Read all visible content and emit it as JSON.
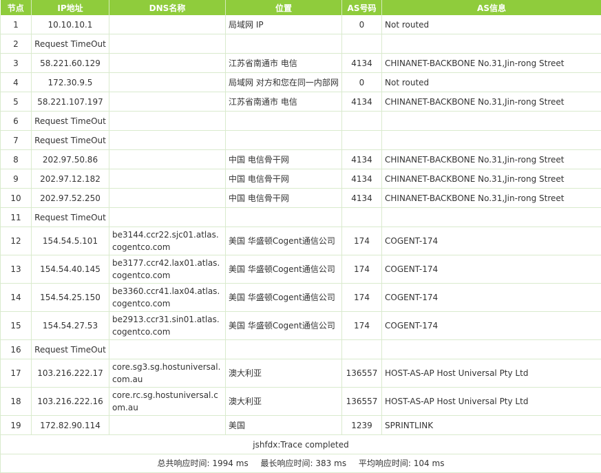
{
  "headers": {
    "node": "节点",
    "ip": "IP地址",
    "dns": "DNS名称",
    "location": "位置",
    "asn": "AS号码",
    "asinfo": "AS信息"
  },
  "rows": [
    {
      "node": "1",
      "ip": "10.10.10.1",
      "dns": "",
      "location": "局域网 IP",
      "asn": "0",
      "asinfo": "Not routed"
    },
    {
      "node": "2",
      "ip": "Request TimeOut",
      "dns": "",
      "location": "",
      "asn": "",
      "asinfo": ""
    },
    {
      "node": "3",
      "ip": "58.221.60.129",
      "dns": "",
      "location": "江苏省南通市 电信",
      "asn": "4134",
      "asinfo": "CHINANET-BACKBONE No.31,Jin-rong Street"
    },
    {
      "node": "4",
      "ip": "172.30.9.5",
      "dns": "",
      "location": "局域网 对方和您在同一内部网",
      "asn": "0",
      "asinfo": "Not routed"
    },
    {
      "node": "5",
      "ip": "58.221.107.197",
      "dns": "",
      "location": "江苏省南通市 电信",
      "asn": "4134",
      "asinfo": "CHINANET-BACKBONE No.31,Jin-rong Street"
    },
    {
      "node": "6",
      "ip": "Request TimeOut",
      "dns": "",
      "location": "",
      "asn": "",
      "asinfo": ""
    },
    {
      "node": "7",
      "ip": "Request TimeOut",
      "dns": "",
      "location": "",
      "asn": "",
      "asinfo": ""
    },
    {
      "node": "8",
      "ip": "202.97.50.86",
      "dns": "",
      "location": "中国 电信骨干网",
      "asn": "4134",
      "asinfo": "CHINANET-BACKBONE No.31,Jin-rong Street"
    },
    {
      "node": "9",
      "ip": "202.97.12.182",
      "dns": "",
      "location": "中国 电信骨干网",
      "asn": "4134",
      "asinfo": "CHINANET-BACKBONE No.31,Jin-rong Street"
    },
    {
      "node": "10",
      "ip": "202.97.52.250",
      "dns": "",
      "location": "中国 电信骨干网",
      "asn": "4134",
      "asinfo": "CHINANET-BACKBONE No.31,Jin-rong Street"
    },
    {
      "node": "11",
      "ip": "Request TimeOut",
      "dns": "",
      "location": "",
      "asn": "",
      "asinfo": ""
    },
    {
      "node": "12",
      "ip": "154.54.5.101",
      "dns": "be3144.ccr22.sjc01.atlas.cogentco.com",
      "location": "美国 华盛顿Cogent通信公司",
      "asn": "174",
      "asinfo": "COGENT-174"
    },
    {
      "node": "13",
      "ip": "154.54.40.145",
      "dns": "be3177.ccr42.lax01.atlas.cogentco.com",
      "location": "美国 华盛顿Cogent通信公司",
      "asn": "174",
      "asinfo": "COGENT-174"
    },
    {
      "node": "14",
      "ip": "154.54.25.150",
      "dns": "be3360.ccr41.lax04.atlas.cogentco.com",
      "location": "美国 华盛顿Cogent通信公司",
      "asn": "174",
      "asinfo": "COGENT-174"
    },
    {
      "node": "15",
      "ip": "154.54.27.53",
      "dns": "be2913.ccr31.sin01.atlas.cogentco.com",
      "location": "美国 华盛顿Cogent通信公司",
      "asn": "174",
      "asinfo": "COGENT-174"
    },
    {
      "node": "16",
      "ip": "Request TimeOut",
      "dns": "",
      "location": "",
      "asn": "",
      "asinfo": ""
    },
    {
      "node": "17",
      "ip": "103.216.222.17",
      "dns": "core.sg3.sg.hostuniversal.com.au",
      "location": "澳大利亚",
      "asn": "136557",
      "asinfo": "HOST-AS-AP Host Universal Pty Ltd"
    },
    {
      "node": "18",
      "ip": "103.216.222.16",
      "dns": "core.rc.sg.hostuniversal.com.au",
      "location": "澳大利亚",
      "asn": "136557",
      "asinfo": "HOST-AS-AP Host Universal Pty Ltd"
    },
    {
      "node": "19",
      "ip": "172.82.90.114",
      "dns": "",
      "location": "美国",
      "asn": "1239",
      "asinfo": "SPRINTLINK"
    }
  ],
  "summary": {
    "status": "jshfdx:Trace completed",
    "total_label": "总共响应时间:",
    "total_value": "1994 ms",
    "max_label": "最长响应时间:",
    "max_value": "383 ms",
    "avg_label": "平均响应时间:",
    "avg_value": "104 ms"
  },
  "colors": {
    "header_bg": "#8fcc3c",
    "border": "#d9eacd"
  }
}
